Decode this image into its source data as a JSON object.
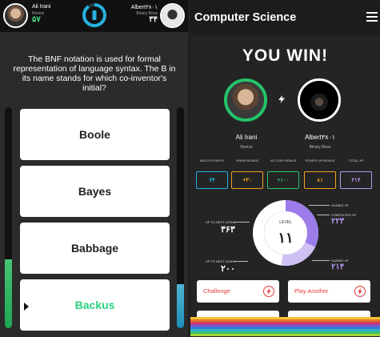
{
  "quiz": {
    "player": {
      "name": "Ali Irani",
      "rank": "Novice",
      "score": "۵۷"
    },
    "opponent": {
      "name": "Albert۳۸۰۱",
      "rank": "Binary Boss",
      "score": "۳۴"
    },
    "timer_progress": 0.9,
    "question": "The BNF notation is used for formal representation of language syntax. The B in its name stands for which co-inventor's initial?",
    "answers": [
      "Boole",
      "Bayes",
      "Babbage",
      "Backus"
    ],
    "correct_index": 3,
    "player_progress": 0.31,
    "opponent_progress": 0.2,
    "colors": {
      "correct": "#2bd382",
      "player_bar": "#1fa653",
      "opponent_bar": "#1d8fb8",
      "timer": "#27b0dc"
    }
  },
  "results": {
    "title": "Computer Science",
    "headline": "YOU WIN!",
    "winner": {
      "name": "Ali Irani",
      "rank": "Novice"
    },
    "loser": {
      "name": "Albert۳۸۰۱",
      "rank": "Binary Boss"
    },
    "stats": [
      {
        "label": "MATCH POINTS",
        "value": "۷۴",
        "color": "#27b0dc"
      },
      {
        "label": "FINISH BONUS",
        "value": "+۳۰",
        "color": "#f0a020"
      },
      {
        "label": "VICTORY BONUS",
        "value": "+۱۰۰",
        "color": "#2bc46a"
      },
      {
        "label": "POWER UP BONUS",
        "value": "x۱",
        "color": "#f0a020"
      },
      {
        "label": "TOTAL XP",
        "value": "۲۱۴",
        "color": "#b79cf2"
      }
    ],
    "level": {
      "label": "LEVEL",
      "value": "۱۱"
    },
    "xp_next_level_top": {
      "label": "XP TO NEXT LEVEL",
      "value": "۳۶۳"
    },
    "xp_next_level_bottom": {
      "label": "XP TO NEXT LEVEL",
      "value": "۲۰۰"
    },
    "gained_xp_label": "GAINED XP",
    "completed_xp_label": "COMPLETED XP",
    "completed_xp_value": "۲۲۳",
    "gained_xp_bottom_label": "GAINED XP",
    "gained_xp_bottom_value": "۲۱۴",
    "level_progress": 0.32,
    "gained_progress": 0.2,
    "actions": {
      "challenge": "Challenge",
      "play_another": "Play Another"
    },
    "colors": {
      "winner_ring": "#23c46a",
      "accent": "#e53a3a",
      "xp": "#b79cf2"
    }
  },
  "icons": [
    "timer-icon",
    "bolt-icon",
    "menu-icon",
    "challenge-bolt-icon",
    "play-another-bolt-icon"
  ]
}
